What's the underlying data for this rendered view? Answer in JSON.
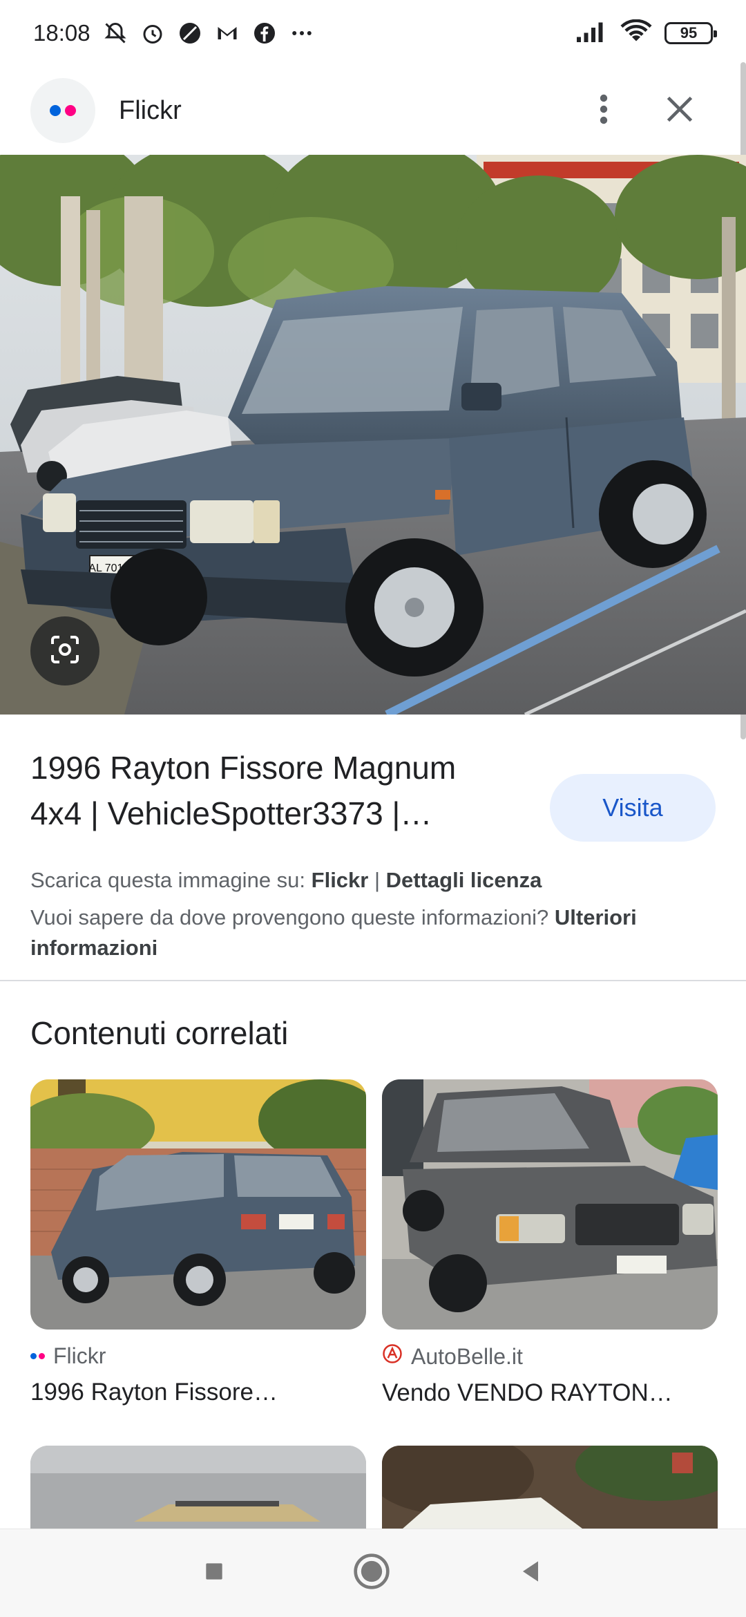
{
  "status_bar": {
    "time": "18:08",
    "battery": "95",
    "icons": [
      "mute-icon",
      "alarm-icon",
      "dnd-icon",
      "gmail-icon",
      "facebook-icon",
      "more-icon",
      "signal-icon",
      "wifi-icon"
    ]
  },
  "header": {
    "site_name": "Flickr",
    "logo_colors": [
      "#0063dc",
      "#ff0084"
    ]
  },
  "result": {
    "title": "1996 Rayton Fissore Magnum 4x4 | VehicleSpotter3373 |…",
    "visit_label": "Visita",
    "download_prefix": "Scarica questa immagine su: ",
    "download_source": "Flickr",
    "separator": " | ",
    "license_link": "Dettagli licenza",
    "info_question": "Vuoi sapere da dove provengono queste informazioni? ",
    "info_link": "Ulteriori informazioni"
  },
  "related": {
    "heading": "Contenuti correlati",
    "items": [
      {
        "source": "Flickr",
        "caption": "1996 Rayton Fissore…"
      },
      {
        "source": "AutoBelle.it",
        "caption": "Vendo VENDO RAYTON…"
      }
    ]
  },
  "colors": {
    "accent": "#1a57c9",
    "visit_bg": "#e8f0fe",
    "autobelle_red": "#d93025"
  }
}
